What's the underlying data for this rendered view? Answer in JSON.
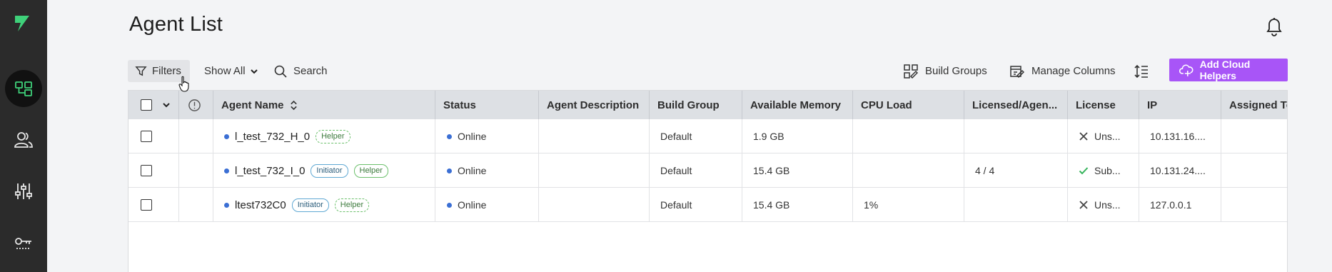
{
  "page": {
    "title": "Agent List"
  },
  "sidebar": {
    "items": [
      {
        "icon": "agents-icon",
        "active": true
      },
      {
        "icon": "users-icon",
        "active": false
      },
      {
        "icon": "sliders-icon",
        "active": false
      },
      {
        "icon": "key-icon",
        "active": false
      }
    ]
  },
  "toolbar": {
    "filters_label": "Filters",
    "show_all_label": "Show All",
    "search_label": "Search",
    "build_groups_label": "Build Groups",
    "manage_columns_label": "Manage Columns",
    "add_cloud_helpers_label": "Add Cloud Helpers"
  },
  "table": {
    "columns": [
      "Agent Name",
      "Status",
      "Agent Description",
      "Build Group",
      "Available Memory",
      "CPU Load",
      "Licensed/Agen...",
      "License",
      "IP",
      "Assigned To"
    ],
    "rows": [
      {
        "name": "l_test_732_H_0",
        "tags": [
          "Helper"
        ],
        "status": "Online",
        "description": "",
        "build_group": "Default",
        "memory": "1.9 GB",
        "cpu": "",
        "licensed": "",
        "license": "Uns...",
        "license_ok": false,
        "ip": "10.131.16....",
        "assigned": ""
      },
      {
        "name": "l_test_732_I_0",
        "tags": [
          "Initiator",
          "Helper"
        ],
        "status": "Online",
        "description": "",
        "build_group": "Default",
        "memory": "15.4 GB",
        "cpu": "",
        "licensed": "4 / 4",
        "license": "Sub...",
        "license_ok": true,
        "ip": "10.131.24....",
        "assigned": ""
      },
      {
        "name": "ltest732C0",
        "tags": [
          "Initiator",
          "Helper"
        ],
        "status": "Online",
        "description": "",
        "build_group": "Default",
        "memory": "15.4 GB",
        "cpu": "1%",
        "licensed": "",
        "license": "Uns...",
        "license_ok": false,
        "ip": "127.0.0.1",
        "assigned": ""
      }
    ]
  },
  "colors": {
    "accent": "#a855f7",
    "sidebar_bg": "#2b2b2b",
    "online_dot": "#3b6fd4",
    "helper_tag": "#6cc06c",
    "initiator_tag": "#5fa8d3"
  }
}
